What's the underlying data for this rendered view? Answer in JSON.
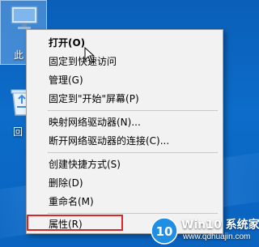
{
  "desktop": {
    "this_pc_label": "此",
    "recycle_bin_label": "回"
  },
  "context_menu": {
    "items": [
      {
        "label": "打开(O)",
        "bold": true
      },
      {
        "label": "固定到快速访问"
      },
      {
        "label": "管理(G)"
      },
      {
        "label": "固定到\"开始\"屏幕(P)"
      },
      {
        "label": "映射网络驱动器(N)..."
      },
      {
        "label": "断开网络驱动器的连接(C)..."
      },
      {
        "label": "创建快捷方式(S)"
      },
      {
        "label": "删除(D)"
      },
      {
        "label": "重命名(M)"
      },
      {
        "label": "属性(R)"
      }
    ],
    "highlighted_item": "属性(R)",
    "highlight_color": "#d9262b"
  },
  "watermark": {
    "title": "Win10 系统家园",
    "url": "www.qdhuajin.com"
  },
  "colors": {
    "desktop_bg": "#0a63bf",
    "menu_bg": "#f2f2f2"
  }
}
